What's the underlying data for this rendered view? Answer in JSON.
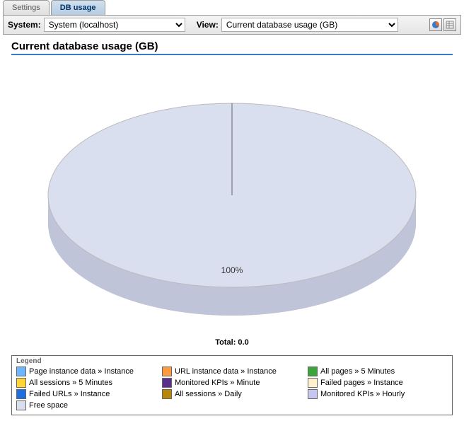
{
  "tabs": {
    "settings": "Settings",
    "db_usage": "DB usage"
  },
  "toolbar": {
    "system_label": "System:",
    "system_value": "System (localhost)",
    "view_label": "View:",
    "view_value": "Current database usage (GB)"
  },
  "chart": {
    "title": "Current database usage (GB)",
    "slice_label": "100%",
    "total_label": "Total: 0.0"
  },
  "chart_data": {
    "type": "pie",
    "title": "Current database usage (GB)",
    "series": [
      {
        "name": "Page instance data » Instance",
        "value": 0,
        "color": "#6eb6ff"
      },
      {
        "name": "URL instance data » Instance",
        "value": 0,
        "color": "#ff9a3d"
      },
      {
        "name": "All pages » 5 Minutes",
        "value": 0,
        "color": "#3aa63a"
      },
      {
        "name": "All sessions » 5 Minutes",
        "value": 0,
        "color": "#ffd633"
      },
      {
        "name": "Monitored KPIs » Minute",
        "value": 0,
        "color": "#5a2f8a"
      },
      {
        "name": "Failed pages » Instance",
        "value": 0,
        "color": "#fff2cc"
      },
      {
        "name": "Failed URLs » Instance",
        "value": 0,
        "color": "#1f6fe0"
      },
      {
        "name": "All sessions » Daily",
        "value": 0,
        "color": "#b8860b"
      },
      {
        "name": "Monitored KPIs » Hourly",
        "value": 0,
        "color": "#c6c6f0"
      },
      {
        "name": "Free space",
        "value": 100,
        "color": "#dadff0"
      }
    ],
    "total": 0.0
  },
  "legend": {
    "title": "Legend",
    "items": [
      {
        "label": "Page instance data » Instance",
        "color": "#6eb6ff"
      },
      {
        "label": "URL instance data » Instance",
        "color": "#ff9a3d"
      },
      {
        "label": "All pages » 5 Minutes",
        "color": "#3aa63a"
      },
      {
        "label": "All sessions » 5 Minutes",
        "color": "#ffd633"
      },
      {
        "label": "Monitored KPIs » Minute",
        "color": "#5a2f8a"
      },
      {
        "label": "Failed pages » Instance",
        "color": "#fff2cc"
      },
      {
        "label": "Failed URLs » Instance",
        "color": "#1f6fe0"
      },
      {
        "label": "All sessions » Daily",
        "color": "#b8860b"
      },
      {
        "label": "Monitored KPIs » Hourly",
        "color": "#c6c6f0"
      },
      {
        "label": "Free space",
        "color": "#dadff0"
      }
    ]
  }
}
